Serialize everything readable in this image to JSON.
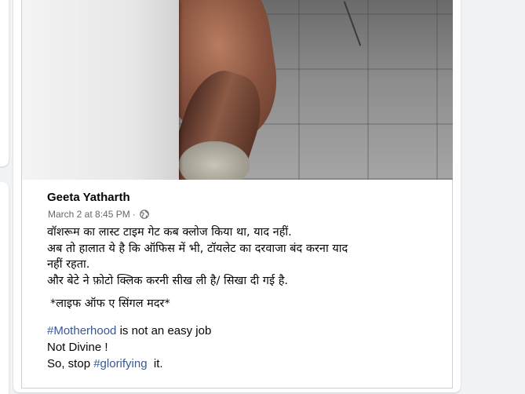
{
  "post": {
    "author": "Geeta Yatharth",
    "timestamp": "March 2 at 8:45 PM",
    "separator": "·",
    "privacy_icon": "globe-icon",
    "photo": {
      "alt": "photo"
    },
    "text_lines": [
      "वॉशरूम का लास्ट टाइम गेट कब क्लोज किया था, याद नहीं.",
      "अब तो हालात ये है कि ऑफिस में भी,  टॉयलेट का दरवाजा बंद करना याद",
      "नहीं  रहता.",
      "और बेटे ने फ़ोटो क्लिक करनी सीख ली है/ सिखा दी गई है."
    ],
    "signature": "*लाइफ ऑफ ए सिंगल मदर*",
    "hashtag_line_1": {
      "tag": "#Motherhood",
      "rest": " is not an easy job"
    },
    "line_2": "Not Divine !",
    "line_3": {
      "before": "So, stop ",
      "tag": "#glorifying",
      "after": "  it."
    }
  },
  "colors": {
    "page_bg": "#f0f2f5",
    "card_bg": "#ffffff",
    "text_primary": "#050505",
    "text_secondary": "#65676b",
    "hashtag": "#385898",
    "border": "#ced0d4"
  }
}
